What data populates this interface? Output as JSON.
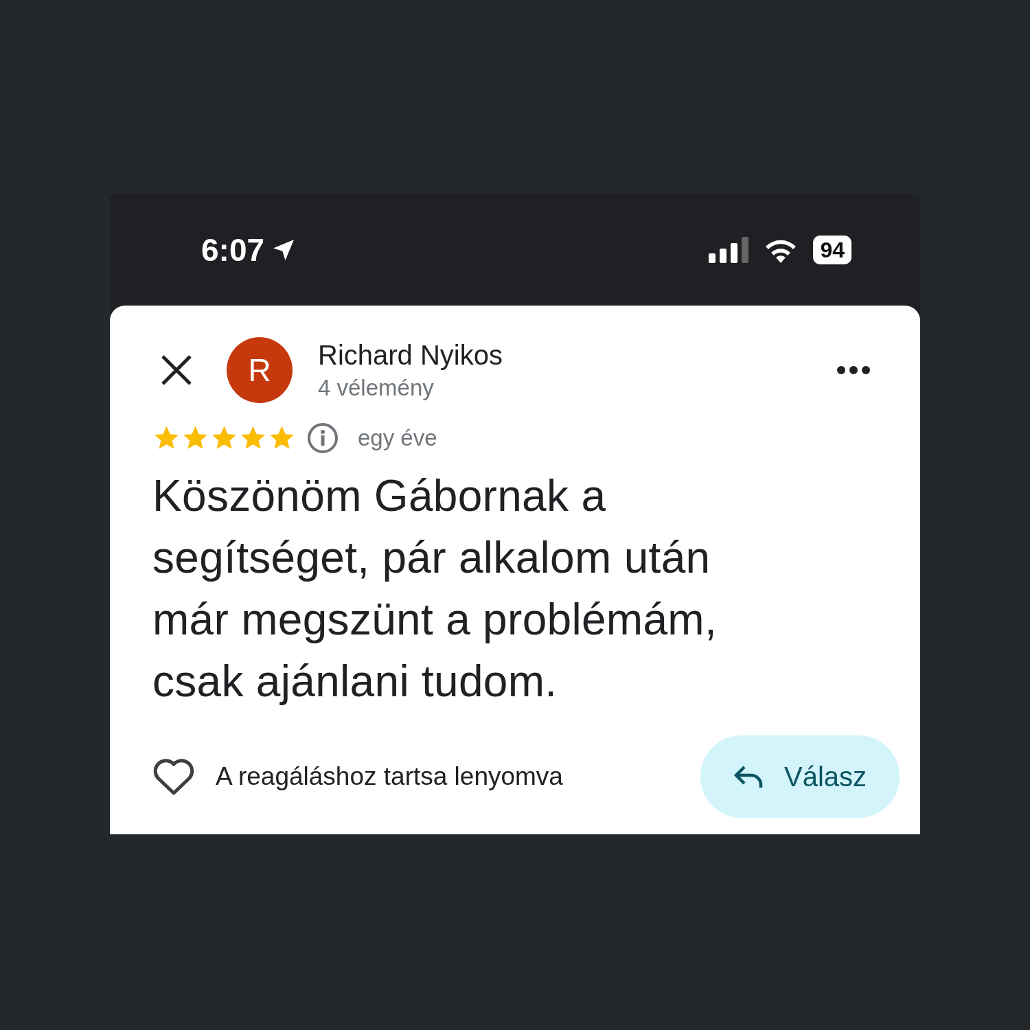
{
  "status_bar": {
    "time": "6:07",
    "battery": "94"
  },
  "review": {
    "avatar_initial": "R",
    "author": "Richard Nyikos",
    "subtitle": "4 vélemény",
    "stars": 5,
    "time": "egy éve",
    "text": "Köszönöm Gábornak a segítséget, pár alkalom után már megszünt a problémám, csak ajánlani tudom.",
    "reaction_hint": "A reagáláshoz tartsa lenyomva",
    "reply_button": "Válasz"
  }
}
